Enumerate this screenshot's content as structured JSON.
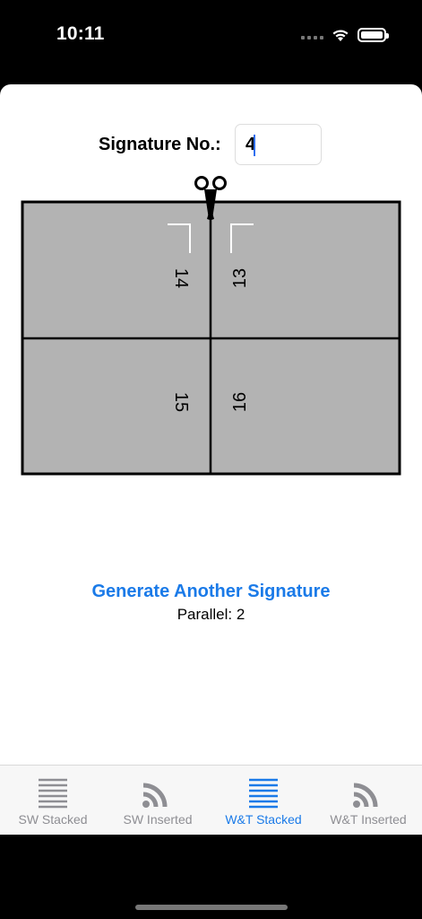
{
  "status_bar": {
    "time": "10:11"
  },
  "signature": {
    "label": "Signature No.:",
    "value": "4"
  },
  "diagram": {
    "pages": [
      "14",
      "13",
      "15",
      "16"
    ],
    "panel_color": "#b3b3b3",
    "line_color": "#000000"
  },
  "actions": {
    "generate_label": "Generate Another Signature",
    "parallel_text": "Parallel: 2"
  },
  "tabs": [
    {
      "label": "SW Stacked",
      "icon": "lines-icon",
      "active": false
    },
    {
      "label": "SW Inserted",
      "icon": "rss-icon",
      "active": false
    },
    {
      "label": "W&T Stacked",
      "icon": "lines-icon",
      "active": true
    },
    {
      "label": "W&T Inserted",
      "icon": "rss-icon",
      "active": false
    }
  ],
  "colors": {
    "accent": "#1a7ae8",
    "inactive": "#8e8e93"
  }
}
